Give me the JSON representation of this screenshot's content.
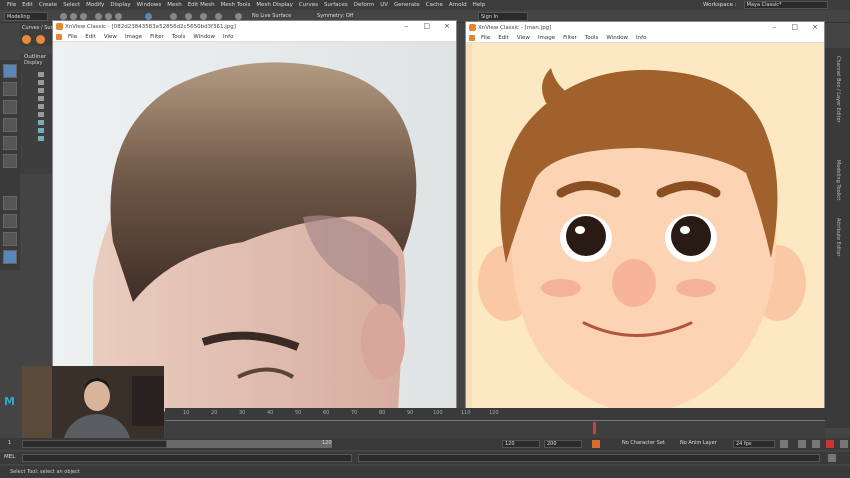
{
  "maya": {
    "menus": [
      "File",
      "Edit",
      "Create",
      "Select",
      "Modify",
      "Display",
      "Windows",
      "Mesh",
      "Edit Mesh",
      "Mesh Tools",
      "Mesh Display",
      "Curves",
      "Surfaces",
      "Deform",
      "UV",
      "Generate",
      "Cache",
      "Arnold",
      "Help"
    ],
    "workspace_label": "Workspace :",
    "workspace_value": "Maya Classic*",
    "mode_select": "Modeling",
    "live_surface": "No Live Surface",
    "symmetry": "Symmetry: Off",
    "signin": "Sign In",
    "shelf_tab": "Curves / Surf",
    "outliner_title": "Outliner",
    "outliner_menu": "Display",
    "range": {
      "start": "1",
      "current": "120",
      "end_a": "120",
      "end_b": "200",
      "char_set": "No Character Set",
      "anim_layer": "No Anim Layer",
      "fps": "24 fps"
    },
    "cmd_label": "MEL",
    "help_text": "Select Tool: select an object",
    "timeline_ticks": [
      "10",
      "20",
      "30",
      "40",
      "50",
      "60",
      "70",
      "80",
      "90",
      "100",
      "110",
      "120"
    ],
    "right_tabs": [
      "Channel Box / Layer Editor",
      "Modeling Toolkit",
      "Attribute Editor"
    ]
  },
  "xview_left": {
    "title": "XnView Classic - [082d23843583e52856d2c5650bd3f361.jpg]",
    "menus": [
      "File",
      "Edit",
      "View",
      "Image",
      "Filter",
      "Tools",
      "Window",
      "Info"
    ]
  },
  "xview_right": {
    "title": "XnView Classic - [man.jpg]",
    "menus": [
      "File",
      "Edit",
      "View",
      "Image",
      "Filter",
      "Tools",
      "Window",
      "Info"
    ]
  },
  "colors": {
    "maya_bg": "#444444",
    "xview_logo": "#e8862e",
    "cartoon_skin": "#fcd4b4",
    "cartoon_hair": "#a0612c",
    "cartoon_bg": "#fde8c4"
  }
}
